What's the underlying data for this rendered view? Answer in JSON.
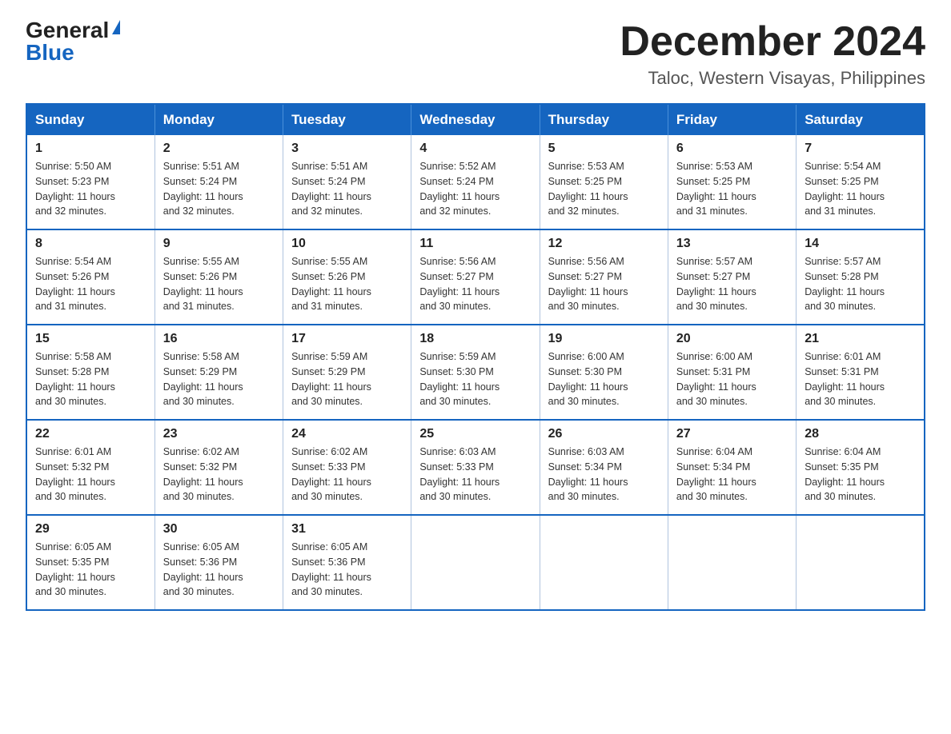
{
  "header": {
    "logo_general": "General",
    "logo_blue": "Blue",
    "month_title": "December 2024",
    "location": "Taloc, Western Visayas, Philippines"
  },
  "weekdays": [
    "Sunday",
    "Monday",
    "Tuesday",
    "Wednesday",
    "Thursday",
    "Friday",
    "Saturday"
  ],
  "weeks": [
    [
      {
        "day": "1",
        "sunrise": "5:50 AM",
        "sunset": "5:23 PM",
        "daylight": "11 hours and 32 minutes."
      },
      {
        "day": "2",
        "sunrise": "5:51 AM",
        "sunset": "5:24 PM",
        "daylight": "11 hours and 32 minutes."
      },
      {
        "day": "3",
        "sunrise": "5:51 AM",
        "sunset": "5:24 PM",
        "daylight": "11 hours and 32 minutes."
      },
      {
        "day": "4",
        "sunrise": "5:52 AM",
        "sunset": "5:24 PM",
        "daylight": "11 hours and 32 minutes."
      },
      {
        "day": "5",
        "sunrise": "5:53 AM",
        "sunset": "5:25 PM",
        "daylight": "11 hours and 32 minutes."
      },
      {
        "day": "6",
        "sunrise": "5:53 AM",
        "sunset": "5:25 PM",
        "daylight": "11 hours and 31 minutes."
      },
      {
        "day": "7",
        "sunrise": "5:54 AM",
        "sunset": "5:25 PM",
        "daylight": "11 hours and 31 minutes."
      }
    ],
    [
      {
        "day": "8",
        "sunrise": "5:54 AM",
        "sunset": "5:26 PM",
        "daylight": "11 hours and 31 minutes."
      },
      {
        "day": "9",
        "sunrise": "5:55 AM",
        "sunset": "5:26 PM",
        "daylight": "11 hours and 31 minutes."
      },
      {
        "day": "10",
        "sunrise": "5:55 AM",
        "sunset": "5:26 PM",
        "daylight": "11 hours and 31 minutes."
      },
      {
        "day": "11",
        "sunrise": "5:56 AM",
        "sunset": "5:27 PM",
        "daylight": "11 hours and 30 minutes."
      },
      {
        "day": "12",
        "sunrise": "5:56 AM",
        "sunset": "5:27 PM",
        "daylight": "11 hours and 30 minutes."
      },
      {
        "day": "13",
        "sunrise": "5:57 AM",
        "sunset": "5:27 PM",
        "daylight": "11 hours and 30 minutes."
      },
      {
        "day": "14",
        "sunrise": "5:57 AM",
        "sunset": "5:28 PM",
        "daylight": "11 hours and 30 minutes."
      }
    ],
    [
      {
        "day": "15",
        "sunrise": "5:58 AM",
        "sunset": "5:28 PM",
        "daylight": "11 hours and 30 minutes."
      },
      {
        "day": "16",
        "sunrise": "5:58 AM",
        "sunset": "5:29 PM",
        "daylight": "11 hours and 30 minutes."
      },
      {
        "day": "17",
        "sunrise": "5:59 AM",
        "sunset": "5:29 PM",
        "daylight": "11 hours and 30 minutes."
      },
      {
        "day": "18",
        "sunrise": "5:59 AM",
        "sunset": "5:30 PM",
        "daylight": "11 hours and 30 minutes."
      },
      {
        "day": "19",
        "sunrise": "6:00 AM",
        "sunset": "5:30 PM",
        "daylight": "11 hours and 30 minutes."
      },
      {
        "day": "20",
        "sunrise": "6:00 AM",
        "sunset": "5:31 PM",
        "daylight": "11 hours and 30 minutes."
      },
      {
        "day": "21",
        "sunrise": "6:01 AM",
        "sunset": "5:31 PM",
        "daylight": "11 hours and 30 minutes."
      }
    ],
    [
      {
        "day": "22",
        "sunrise": "6:01 AM",
        "sunset": "5:32 PM",
        "daylight": "11 hours and 30 minutes."
      },
      {
        "day": "23",
        "sunrise": "6:02 AM",
        "sunset": "5:32 PM",
        "daylight": "11 hours and 30 minutes."
      },
      {
        "day": "24",
        "sunrise": "6:02 AM",
        "sunset": "5:33 PM",
        "daylight": "11 hours and 30 minutes."
      },
      {
        "day": "25",
        "sunrise": "6:03 AM",
        "sunset": "5:33 PM",
        "daylight": "11 hours and 30 minutes."
      },
      {
        "day": "26",
        "sunrise": "6:03 AM",
        "sunset": "5:34 PM",
        "daylight": "11 hours and 30 minutes."
      },
      {
        "day": "27",
        "sunrise": "6:04 AM",
        "sunset": "5:34 PM",
        "daylight": "11 hours and 30 minutes."
      },
      {
        "day": "28",
        "sunrise": "6:04 AM",
        "sunset": "5:35 PM",
        "daylight": "11 hours and 30 minutes."
      }
    ],
    [
      {
        "day": "29",
        "sunrise": "6:05 AM",
        "sunset": "5:35 PM",
        "daylight": "11 hours and 30 minutes."
      },
      {
        "day": "30",
        "sunrise": "6:05 AM",
        "sunset": "5:36 PM",
        "daylight": "11 hours and 30 minutes."
      },
      {
        "day": "31",
        "sunrise": "6:05 AM",
        "sunset": "5:36 PM",
        "daylight": "11 hours and 30 minutes."
      },
      null,
      null,
      null,
      null
    ]
  ],
  "labels": {
    "sunrise": "Sunrise:",
    "sunset": "Sunset:",
    "daylight": "Daylight:"
  }
}
